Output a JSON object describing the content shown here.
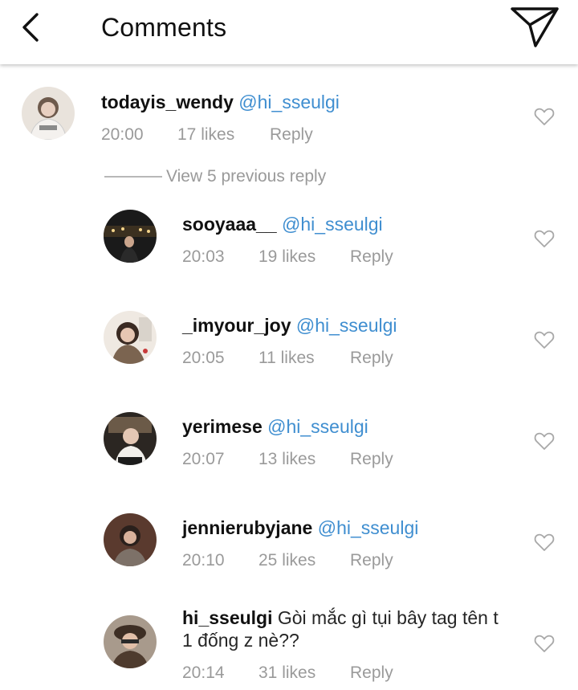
{
  "header": {
    "title": "Comments"
  },
  "top_comment": {
    "username": "todayis_wendy",
    "mention": "@hi_sseulgi",
    "time": "20:00",
    "likes": "17 likes",
    "reply": "Reply"
  },
  "view_previous": "View 5 previous reply",
  "replies": [
    {
      "username": "sooyaaa__",
      "mention": "@hi_sseulgi",
      "text": "",
      "time": "20:03",
      "likes": "19 likes",
      "reply": "Reply"
    },
    {
      "username": "_imyour_joy",
      "mention": "@hi_sseulgi",
      "text": "",
      "time": "20:05",
      "likes": "11 likes",
      "reply": "Reply"
    },
    {
      "username": "yerimese",
      "mention": "@hi_sseulgi",
      "text": "",
      "time": "20:07",
      "likes": "13 likes",
      "reply": "Reply"
    },
    {
      "username": "jennierubyjane",
      "mention": "@hi_sseulgi",
      "text": "",
      "time": "20:10",
      "likes": "25 likes",
      "reply": "Reply"
    },
    {
      "username": "hi_sseulgi",
      "mention": "",
      "text": "Gòi mắc gì tụi bây tag tên t 1 đống z nè??",
      "time": "20:14",
      "likes": "31 likes",
      "reply": "Reply"
    }
  ],
  "colors": {
    "mention": "#3f8ed0",
    "meta": "#9a9a9a",
    "text": "#262626"
  },
  "icons": [
    "back-arrow-icon",
    "send-direct-icon",
    "heart-outline-icon"
  ]
}
